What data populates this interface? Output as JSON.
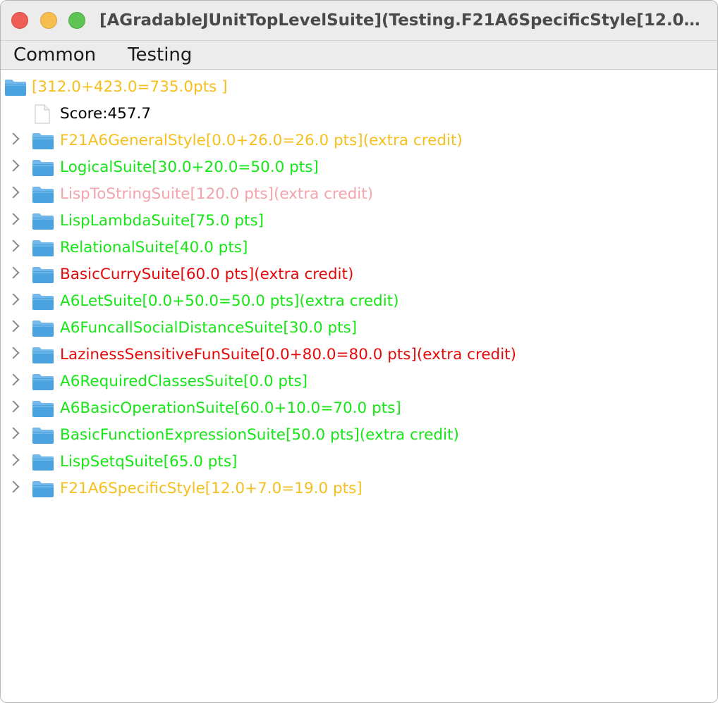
{
  "window": {
    "title": "[AGradableJUnitTopLevelSuite](Testing.F21A6SpecificStyle[12.0+..."
  },
  "menubar": {
    "items": [
      {
        "label": "Common"
      },
      {
        "label": "Testing"
      }
    ]
  },
  "colors": {
    "yellow": "#f5bf1d",
    "green": "#16e616",
    "pink": "#f2a5ad",
    "red": "#e50a0a",
    "folder": "#4aa3df",
    "folder_tab": "#73b8e8",
    "text_default": "#000000"
  },
  "tree": {
    "root": {
      "label": "[312.0+423.0=735.0pts ]",
      "color": "#f5bf1d",
      "icon": "folder-open-icon"
    },
    "score": {
      "label": "Score:457.7",
      "icon": "file-icon"
    },
    "items": [
      {
        "label": "F21A6GeneralStyle[0.0+26.0=26.0 pts](extra credit)",
        "color": "#f5bf1d"
      },
      {
        "label": "LogicalSuite[30.0+20.0=50.0 pts]",
        "color": "#16e616"
      },
      {
        "label": "LispToStringSuite[120.0 pts](extra credit)",
        "color": "#f2a5ad"
      },
      {
        "label": "LispLambdaSuite[75.0 pts]",
        "color": "#16e616"
      },
      {
        "label": "RelationalSuite[40.0 pts]",
        "color": "#16e616"
      },
      {
        "label": "BasicCurrySuite[60.0 pts](extra credit)",
        "color": "#e50a0a"
      },
      {
        "label": "A6LetSuite[0.0+50.0=50.0 pts](extra credit)",
        "color": "#16e616"
      },
      {
        "label": "A6FuncallSocialDistanceSuite[30.0 pts]",
        "color": "#16e616"
      },
      {
        "label": "LazinessSensitiveFunSuite[0.0+80.0=80.0 pts](extra credit)",
        "color": "#e50a0a"
      },
      {
        "label": "A6RequiredClassesSuite[0.0 pts]",
        "color": "#16e616"
      },
      {
        "label": "A6BasicOperationSuite[60.0+10.0=70.0 pts]",
        "color": "#16e616"
      },
      {
        "label": "BasicFunctionExpressionSuite[50.0 pts](extra credit)",
        "color": "#16e616"
      },
      {
        "label": "LispSetqSuite[65.0 pts]",
        "color": "#16e616"
      },
      {
        "label": "F21A6SpecificStyle[12.0+7.0=19.0 pts]",
        "color": "#f5bf1d"
      }
    ]
  }
}
